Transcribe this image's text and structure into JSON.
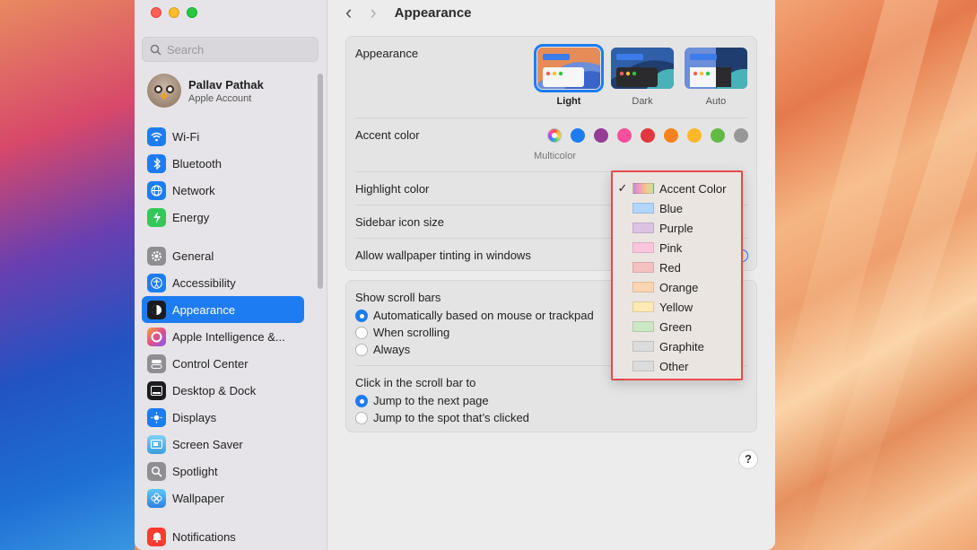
{
  "window": {
    "title": "Appearance"
  },
  "sidebar": {
    "search_placeholder": "Search",
    "account": {
      "name": "Pallav Pathak",
      "subtitle": "Apple Account"
    },
    "groups": [
      [
        {
          "label": "Wi-Fi",
          "icon": "wifi-icon",
          "color": "#1e7cf2"
        },
        {
          "label": "Bluetooth",
          "icon": "bluetooth-icon",
          "color": "#1e7cf2"
        },
        {
          "label": "Network",
          "icon": "globe-icon",
          "color": "#1e7cf2"
        },
        {
          "label": "Energy",
          "icon": "bolt-icon",
          "color": "#34c759"
        }
      ],
      [
        {
          "label": "General",
          "icon": "gear-icon",
          "color": "#8e8e93"
        },
        {
          "label": "Accessibility",
          "icon": "accessibility-icon",
          "color": "#1e7cf2"
        },
        {
          "label": "Appearance",
          "icon": "appearance-icon",
          "color": "#1c1c1e",
          "active": true
        },
        {
          "label": "Apple Intelligence &...",
          "icon": "apple-intelligence-icon",
          "color": "#e04f8a"
        },
        {
          "label": "Control Center",
          "icon": "control-center-icon",
          "color": "#8e8e93"
        },
        {
          "label": "Desktop & Dock",
          "icon": "dock-icon",
          "color": "#1c1c1e"
        },
        {
          "label": "Displays",
          "icon": "sun-icon",
          "color": "#1e7cf2"
        },
        {
          "label": "Screen Saver",
          "icon": "screen-saver-icon",
          "color": "#5ab8e8"
        },
        {
          "label": "Spotlight",
          "icon": "magnifier-icon",
          "color": "#8e8e93"
        },
        {
          "label": "Wallpaper",
          "icon": "flower-icon",
          "color": "#3aa0e8"
        }
      ],
      [
        {
          "label": "Notifications",
          "icon": "bell-icon",
          "color": "#ff3b30"
        }
      ]
    ]
  },
  "appearance": {
    "label": "Appearance",
    "modes": [
      {
        "label": "Light",
        "selected": true
      },
      {
        "label": "Dark",
        "selected": false
      },
      {
        "label": "Auto",
        "selected": false
      }
    ]
  },
  "accent": {
    "label": "Accent color",
    "caption": "Multicolor",
    "colors": [
      "multicolor",
      "#1e7cf2",
      "#953d96",
      "#f74f9e",
      "#e0383e",
      "#f7821b",
      "#fcb827",
      "#62ba46",
      "#989898"
    ]
  },
  "highlight": {
    "label": "Highlight color"
  },
  "sidebar_icon_size": {
    "label": "Sidebar icon size"
  },
  "wallpaper_tinting": {
    "label": "Allow wallpaper tinting in windows"
  },
  "scroll_bars": {
    "label": "Show scroll bars",
    "options": [
      {
        "label": "Automatically based on mouse or trackpad",
        "selected": true
      },
      {
        "label": "When scrolling",
        "selected": false
      },
      {
        "label": "Always",
        "selected": false
      }
    ]
  },
  "click_scroll": {
    "label": "Click in the scroll bar to",
    "options": [
      {
        "label": "Jump to the next page",
        "selected": true
      },
      {
        "label": "Jump to the spot that’s clicked",
        "selected": false
      }
    ]
  },
  "help_label": "?",
  "highlight_menu": {
    "items": [
      {
        "label": "Accent Color",
        "checked": true,
        "chip": "linear-gradient(90deg,#c78cd6,#f0a0b8,#f5c98a,#c2e0a8)"
      },
      {
        "label": "Blue",
        "checked": false,
        "chip": "#b3d5fa"
      },
      {
        "label": "Purple",
        "checked": false,
        "chip": "#dcc3e2"
      },
      {
        "label": "Pink",
        "checked": false,
        "chip": "#fac5dd"
      },
      {
        "label": "Red",
        "checked": false,
        "chip": "#f3c1c2"
      },
      {
        "label": "Orange",
        "checked": false,
        "chip": "#fbd5b1"
      },
      {
        "label": "Yellow",
        "checked": false,
        "chip": "#fce9b4"
      },
      {
        "label": "Green",
        "checked": false,
        "chip": "#cce7c3"
      },
      {
        "label": "Graphite",
        "checked": false,
        "chip": "#dcdcdc"
      },
      {
        "label": "Other",
        "checked": false,
        "chip": "#dcdcdc"
      }
    ]
  }
}
